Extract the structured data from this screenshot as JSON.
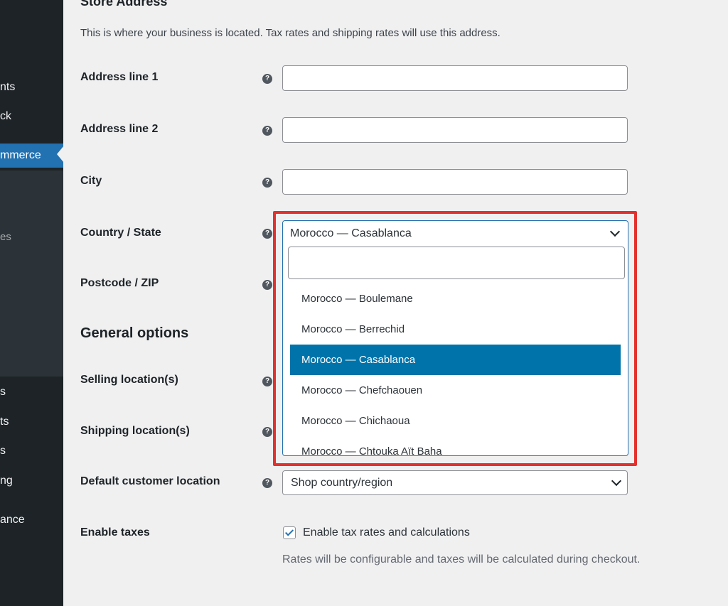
{
  "sidebar": {
    "items": [
      {
        "label": "nts"
      },
      {
        "label": "ck"
      },
      {
        "label": "mmerce"
      },
      {
        "label": "es"
      },
      {
        "label": "s"
      },
      {
        "label": "ts"
      },
      {
        "label": "s"
      },
      {
        "label": "ng"
      },
      {
        "label": "ance"
      }
    ]
  },
  "store_address": {
    "title": "Store Address",
    "description": "This is where your business is located. Tax rates and shipping rates will use this address.",
    "address1_label": "Address line 1",
    "address1_value": "",
    "address2_label": "Address line 2",
    "address2_value": "",
    "city_label": "City",
    "city_value": "",
    "country_label": "Country / State",
    "postcode_label": "Postcode / ZIP"
  },
  "country_dropdown": {
    "selected": "Morocco — Casablanca",
    "search_value": "",
    "options": [
      "Morocco — Boulemane",
      "Morocco — Berrechid",
      "Morocco — Casablanca",
      "Morocco — Chefchaouen",
      "Morocco — Chichaoua",
      "Morocco — Chtouka Aït Baha"
    ],
    "selected_index": 2
  },
  "general_options": {
    "title": "General options",
    "selling_label": "Selling location(s)",
    "shipping_label": "Shipping location(s)",
    "default_customer_label": "Default customer location",
    "default_customer_value": "Shop country/region",
    "enable_taxes_label": "Enable taxes",
    "enable_taxes_checkbox_label": "Enable tax rates and calculations",
    "enable_taxes_checked": true,
    "enable_taxes_desc": "Rates will be configurable and taxes will be calculated during checkout."
  },
  "help_icon_glyph": "?",
  "colors": {
    "sidebar_bg": "#1d2327",
    "accent": "#2271b1",
    "highlight_border": "#e3312d",
    "option_selected": "#0073aa"
  }
}
